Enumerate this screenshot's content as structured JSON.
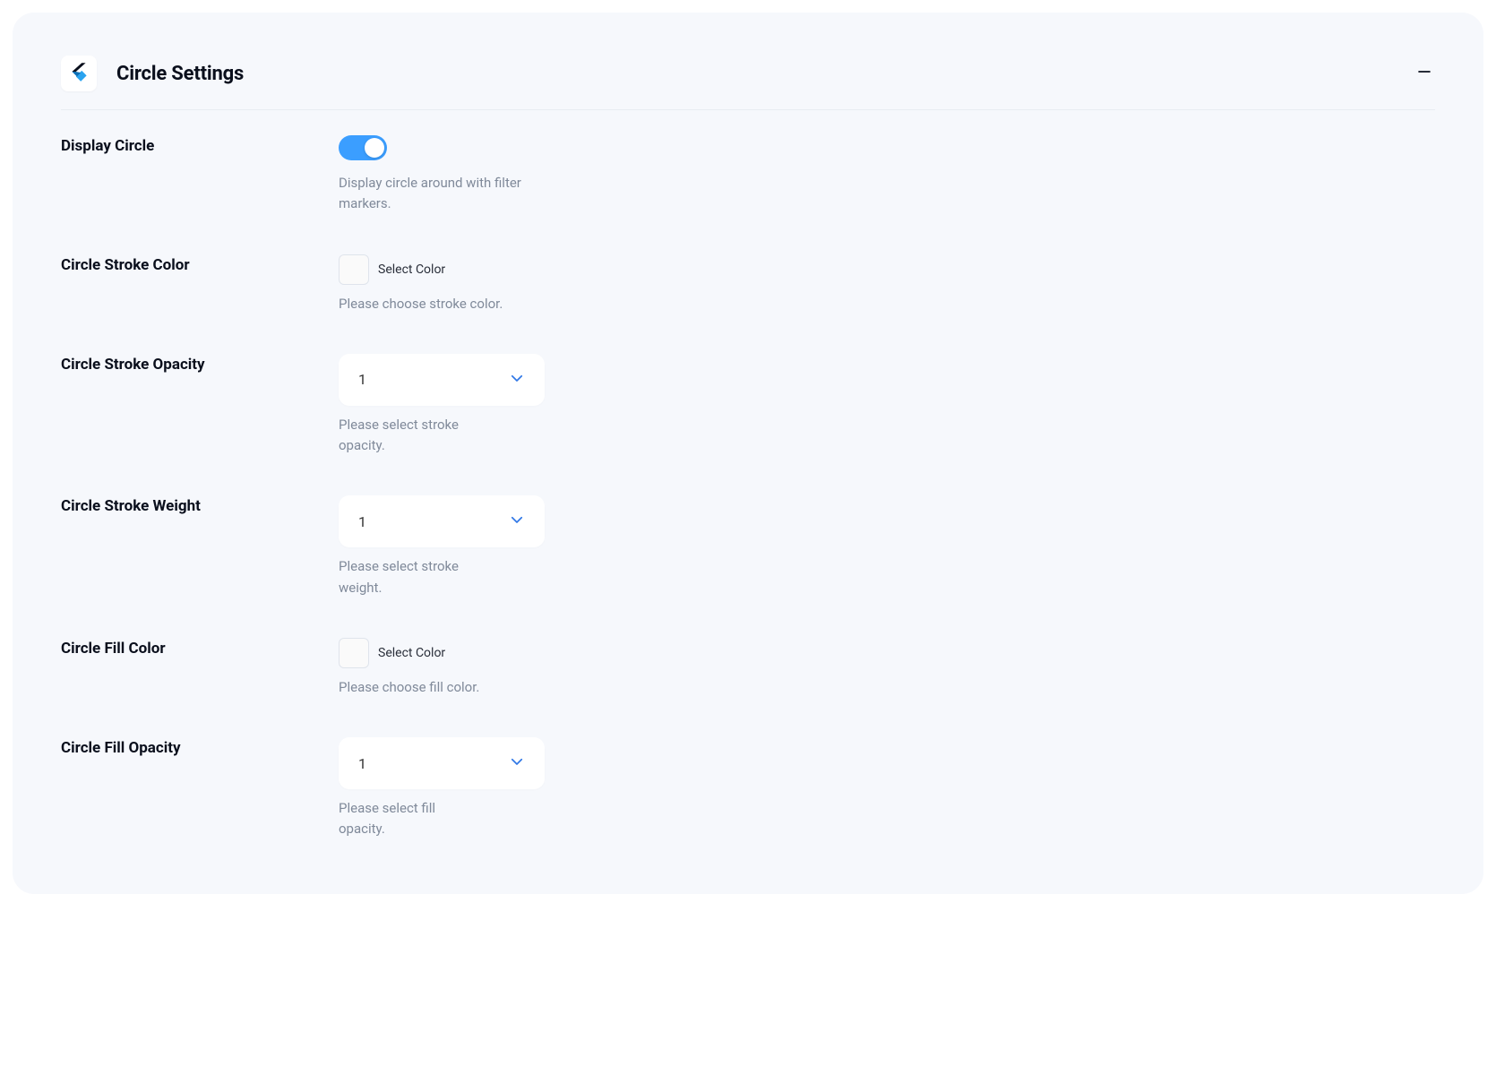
{
  "panel": {
    "title": "Circle Settings"
  },
  "fields": {
    "display_circle": {
      "label": "Display Circle",
      "help": "Display circle around with filter markers.",
      "value": true
    },
    "stroke_color": {
      "label": "Circle Stroke Color",
      "button": "Select Color",
      "help": "Please choose stroke color.",
      "value": "#ffffff"
    },
    "stroke_opacity": {
      "label": "Circle Stroke Opacity",
      "value": "1",
      "help": "Please select stroke opacity."
    },
    "stroke_weight": {
      "label": "Circle Stroke Weight",
      "value": "1",
      "help": "Please select stroke weight."
    },
    "fill_color": {
      "label": "Circle Fill Color",
      "button": "Select Color",
      "help": "Please choose fill color.",
      "value": "#ffffff"
    },
    "fill_opacity": {
      "label": "Circle Fill Opacity",
      "value": "1",
      "help": "Please select fill opacity."
    }
  }
}
